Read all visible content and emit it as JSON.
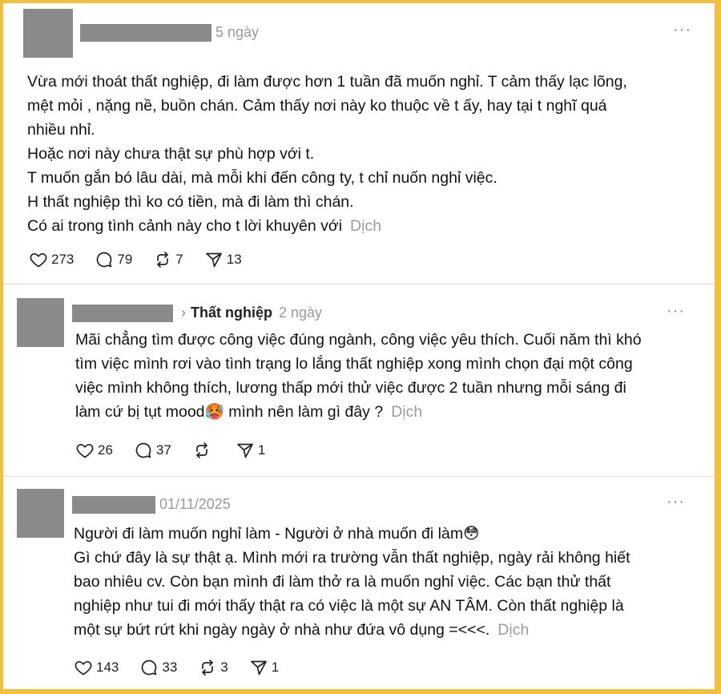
{
  "posts": [
    {
      "time": "5 ngày",
      "text": "Vừa mới thoát thất nghiệp, đi làm được hơn 1 tuần đã muốn nghỉ. T cảm thấy lạc lõng,\nmệt mỏi , nặng nề, buồn chán. Cảm thấy nơi này ko thuộc về t ấy, hay tại t nghĩ quá\nnhiều nhỉ.\nHoặc nơi này chưa thật sự phù hợp với t.\nT muốn gắn bó lâu dài, mà mỗi khi đến công ty, t chỉ nuốn nghỉ việc.\nH thất nghiệp thì ko có tiền, mà đi làm thì chán.\nCó ai trong tình cảnh này cho t lời khuyên với",
      "translate": "Dịch",
      "likes": "273",
      "replies": "79",
      "reposts": "7",
      "shares": "13"
    },
    {
      "topic": "Thất nghiệp",
      "time": "2 ngày",
      "text": "Mãi chẳng tìm được công việc đúng ngành, công việc yêu thích. Cuối năm thì khó\ntìm việc mình rơi vào tình trạng lo lắng thất nghiệp xong mình chọn đại một công\nviệc mình không thích, lương thấp mới thử việc được 2 tuần nhưng mỗi sáng đi\nlàm cứ bị tụt mood🥵  mình nên làm gì đây ?",
      "translate": "Dịch",
      "likes": "26",
      "replies": "37",
      "reposts": "",
      "shares": "1"
    },
    {
      "time": "01/11/2025",
      "text": "Người đi làm muốn nghỉ làm - Người ở nhà muốn đi làm😳\nGì chứ đây là sự thật ạ. Mình mới ra trường vẫn thất nghiệp, ngày rải không hiết\nbao nhiêu cv. Còn bạn mình đi làm thở ra là muốn nghỉ việc. Các bạn thử thất\nnghiệp như tui đi mới thấy thật ra có việc là một sự AN TÂM. Còn thất nghiệp là\nmột sự bứt rứt khi ngày ngày ở nhà như đứa vô dụng =<<<.",
      "translate": "Dịch",
      "likes": "143",
      "replies": "33",
      "reposts": "3",
      "shares": "1"
    }
  ],
  "more_label": "···",
  "colors": {
    "border": "#f4bf3c",
    "redaction": "#8a8a8a",
    "muted": "#9a9a9a"
  }
}
